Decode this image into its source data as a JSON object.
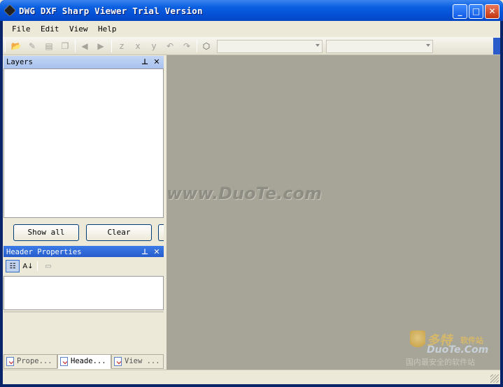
{
  "window": {
    "title": "DWG DXF Sharp Viewer Trial Version"
  },
  "title_buttons": {
    "minimize": "_",
    "maximize": "□",
    "close": "✕"
  },
  "menu": [
    {
      "label": "File"
    },
    {
      "label": "Edit"
    },
    {
      "label": "View"
    },
    {
      "label": "Help"
    }
  ],
  "toolbar": {
    "icons": [
      "open-icon",
      "save-icon",
      "print-icon",
      "copy-icon",
      "back-icon",
      "forward-icon",
      "z-axis-icon",
      "x-axis-icon",
      "y-axis-icon",
      "rotate-left-icon",
      "rotate-right-icon",
      "3d-box-icon"
    ],
    "combo1_value": "",
    "combo2_value": ""
  },
  "layers_panel": {
    "title": "Layers",
    "show_all": "Show all",
    "clear": "Clear"
  },
  "header_panel": {
    "title": "Header Properties"
  },
  "tabs": [
    {
      "label": "Prope..."
    },
    {
      "label": "Heade..."
    },
    {
      "label": "View ..."
    }
  ],
  "watermark": {
    "url": "www.DuoTe.com",
    "logo_cn": "多特",
    "logo_cn_sub": "软件站",
    "logo_en": "DuoTe.Com",
    "logo_slogan": "国内最安全的软件站"
  }
}
